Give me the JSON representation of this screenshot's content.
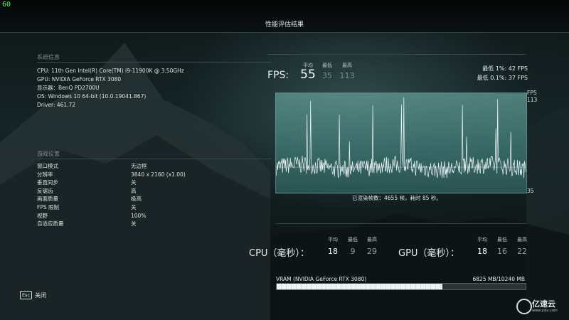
{
  "overlay": {
    "fps_counter": "60"
  },
  "header": {
    "title": "性能评估结果"
  },
  "system": {
    "section_title": "系统信息",
    "lines": [
      "CPU:  11th Gen Intel(R) Core(TM) i9-11900K @ 3.50GHz",
      "GPU: NVIDIA GeForce RTX 3080",
      "显示器：BenQ PD2700U",
      "OS: Windows 10  64-bit (10.0.19041.867)",
      "Driver: 461.72"
    ]
  },
  "settings": {
    "section_title": "游戏设置",
    "rows": [
      {
        "label": "窗口模式",
        "value": "无边框"
      },
      {
        "label": "分辨率",
        "value": "3840 x 2160 (x1.00)"
      },
      {
        "label": "垂直同步",
        "value": "关"
      },
      {
        "label": "反锯齿",
        "value": "高"
      },
      {
        "label": "画面质量",
        "value": "极高"
      },
      {
        "label": "FPS 限制",
        "value": "关"
      },
      {
        "label": "视野",
        "value": "100%"
      },
      {
        "label": "自适应质量",
        "value": "关"
      }
    ]
  },
  "fps": {
    "label": "FPS:",
    "headers": {
      "avg": "平均",
      "min": "最低",
      "max": "最高"
    },
    "avg": "55",
    "min": "35",
    "max": "113",
    "low1": "最低 1%:  42 FPS",
    "low01": "最低 0.1%:  37 FPS"
  },
  "graph": {
    "axis_top_unit": "FPS",
    "axis_top_value": "113",
    "axis_bottom_value": "35",
    "frame_summary": "已渲染帧数：4655 帧，耗时 85 秒。"
  },
  "cpu": {
    "label": "CPU（毫秒）：",
    "headers": {
      "avg": "平均",
      "min": "最低",
      "max": "最高"
    },
    "avg": "18",
    "min": "9",
    "max": "29"
  },
  "gpu": {
    "label": "GPU（毫秒）：",
    "headers": {
      "avg": "平均",
      "min": "最低",
      "max": "最高"
    },
    "avg": "18",
    "min": "16",
    "max": "22"
  },
  "vram": {
    "label": "VRAM (NVIDIA GeForce RTX 3080)",
    "usage": "6825 MB/10240 MB",
    "used_fraction": 0.667
  },
  "footer": {
    "esc_key": "Esc",
    "close_label": "关闭"
  },
  "watermark": {
    "name": "亿速云",
    "sub": "www.yisu.com"
  },
  "colors": {
    "primary_text": "#e6eef0",
    "muted_text": "#7f8e90",
    "fps_counter": "#46ff46",
    "graph_fill": "#5a9490"
  }
}
